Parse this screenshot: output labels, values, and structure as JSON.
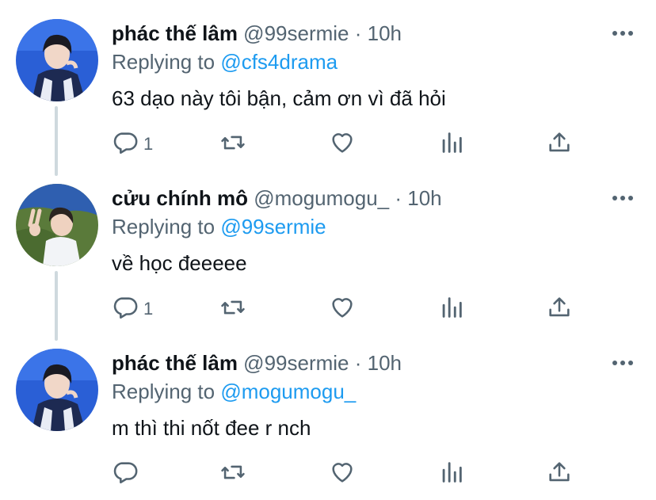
{
  "tweets": [
    {
      "name": "phác thế lâm",
      "handle": "@99sermie",
      "dot": "·",
      "time": "10h",
      "replying_prefix": "Replying to",
      "replying_to": "@cfs4drama",
      "text": "63 dạo này tôi bận, cảm ơn vì đã hỏi",
      "reply_count": "1",
      "avatar": "avatar-blue-jacket"
    },
    {
      "name": "cửu chính mô",
      "handle": "@mogumogu_",
      "dot": "·",
      "time": "10h",
      "replying_prefix": "Replying to",
      "replying_to": "@99sermie",
      "text": "về học đeeeee",
      "reply_count": "1",
      "avatar": "avatar-peace-sign"
    },
    {
      "name": "phác thế lâm",
      "handle": "@99sermie",
      "dot": "·",
      "time": "10h",
      "replying_prefix": "Replying to",
      "replying_to": "@mogumogu_",
      "text": "m thì thi nốt đee r nch",
      "reply_count": "",
      "avatar": "avatar-blue-jacket"
    }
  ],
  "icons": {
    "reply": "reply-icon",
    "retweet": "retweet-icon",
    "like": "like-icon",
    "views": "views-icon",
    "share": "share-icon",
    "more": "more-icon"
  },
  "colors": {
    "link": "#1d9bf0",
    "secondary": "#536471",
    "text": "#0f1419",
    "thread": "#cfd9de"
  }
}
